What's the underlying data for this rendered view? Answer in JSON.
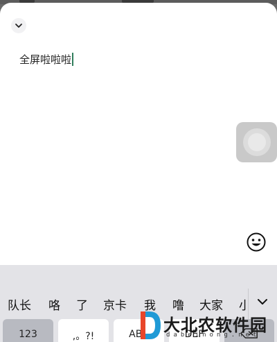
{
  "sheet": {
    "collapse_icon": "chevron-down-icon"
  },
  "editor": {
    "text": "全屏啦啦啦"
  },
  "floating_ball": {
    "icon": "assistive-touch-icon"
  },
  "emoji_button": {
    "icon": "smiley-face-icon"
  },
  "keyboard": {
    "candidates": [
      "队长",
      "咯",
      "了",
      "京卡",
      "我",
      "噜",
      "大家",
      "小"
    ],
    "expand_icon": "chevron-down-icon",
    "keys": [
      {
        "label": "123"
      },
      {
        "label": ",。?!"
      },
      {
        "label": "ABC"
      },
      {
        "label": "DEF"
      }
    ],
    "delete_icon": "backspace-icon"
  },
  "watermark": {
    "text": "大北农软件园",
    "sub": "dabeinong.net"
  },
  "colors": {
    "caret": "#2f7d5b",
    "keyboard_bg": "#e3e3e7",
    "dim_overlay": "#6a6a6a"
  }
}
